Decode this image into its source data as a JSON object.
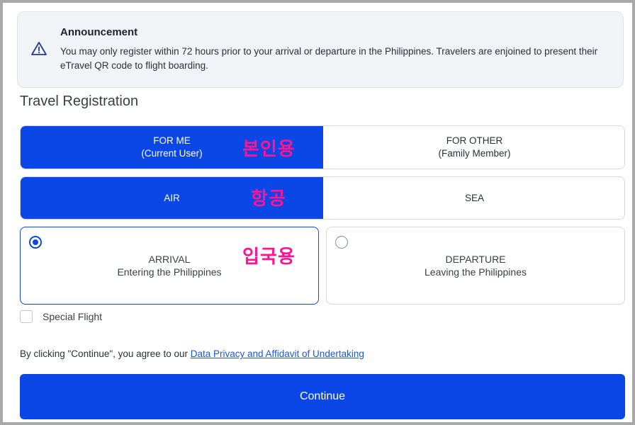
{
  "announcement": {
    "title": "Announcement",
    "text": "You may only register within 72 hours prior to your arrival or departure in the Philippines. Travelers are enjoined to present their eTravel QR code to flight boarding.",
    "icon": "warning-triangle-icon"
  },
  "section_title": "Travel Registration",
  "who": {
    "options": [
      {
        "line1": "FOR ME",
        "line2": "(Current User)",
        "selected": true
      },
      {
        "line1": "FOR OTHER",
        "line2": "(Family Member)",
        "selected": false
      }
    ]
  },
  "mode": {
    "options": [
      {
        "label": "AIR",
        "selected": true
      },
      {
        "label": "SEA",
        "selected": false
      }
    ]
  },
  "direction": {
    "options": [
      {
        "title": "ARRIVAL",
        "subtitle": "Entering the Philippines",
        "selected": true
      },
      {
        "title": "DEPARTURE",
        "subtitle": "Leaving the Philippines",
        "selected": false
      }
    ]
  },
  "annotations": {
    "who": "본인용",
    "mode": "항공",
    "direction": "입국용"
  },
  "special_flight": {
    "label": "Special Flight",
    "checked": false
  },
  "consent": {
    "text": "By clicking \"Continue\", you agree to our ",
    "link": "Data Privacy and Affidavit of Undertaking"
  },
  "continue_label": "Continue",
  "colors": {
    "primary": "#0a47e6",
    "annotation": "#ff1493",
    "announcement_bg": "#f1f3f6"
  }
}
